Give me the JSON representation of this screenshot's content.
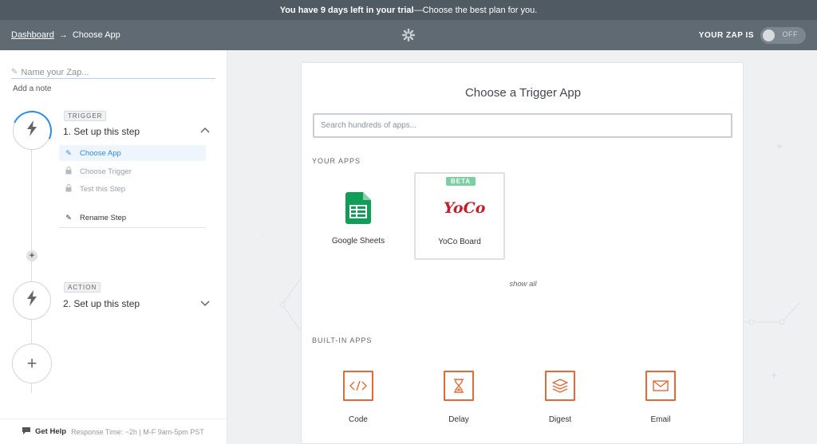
{
  "trial": {
    "lead": "You have 9 days left in your trial",
    "rest": " —Choose the best plan for you."
  },
  "header": {
    "breadcrumb_link": "Dashboard",
    "breadcrumb_sep": "→",
    "breadcrumb_current": "Choose App",
    "zap_status_label": "YOUR ZAP IS",
    "toggle_state": "OFF"
  },
  "sidebar": {
    "zap_name_placeholder": "Name your Zap...",
    "add_note": "Add a note",
    "trigger": {
      "tag": "TRIGGER",
      "title": "1. Set up this step",
      "substeps": [
        {
          "label": "Choose App",
          "active": true
        },
        {
          "label": "Choose Trigger",
          "active": false
        },
        {
          "label": "Test this Step",
          "active": false
        }
      ],
      "rename": "Rename Step"
    },
    "action": {
      "tag": "ACTION",
      "title": "2. Set up this step"
    },
    "help": {
      "label": "Get Help",
      "info": "Response Time: ~2h | M-F 9am-5pm PST"
    }
  },
  "main": {
    "title": "Choose a Trigger App",
    "search_placeholder": "Search hundreds of apps...",
    "your_apps_label": "YOUR APPS",
    "your_apps": [
      {
        "name": "Google Sheets"
      },
      {
        "name": "YoCo Board",
        "badge": "BETA",
        "logo_text": "YoCo"
      }
    ],
    "show_all": "show all",
    "builtin_label": "BUILT-IN APPS",
    "builtin_apps": [
      {
        "name": "Code"
      },
      {
        "name": "Delay"
      },
      {
        "name": "Digest"
      },
      {
        "name": "Email"
      }
    ]
  },
  "colors": {
    "accent_blue": "#2b8de1",
    "builtin_orange": "#e06a3a",
    "beta_green": "#7ccfa0",
    "sheets_green": "#0f9d58"
  }
}
